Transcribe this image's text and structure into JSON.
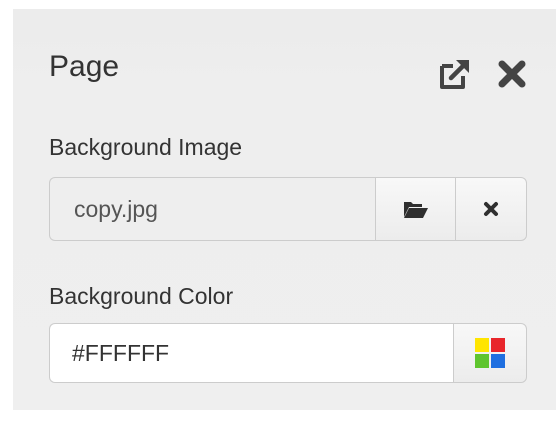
{
  "panel": {
    "title": "Page",
    "popout_icon": "external-link-icon",
    "close_icon": "close-icon"
  },
  "background_image": {
    "label": "Background Image",
    "value": "copy.jpg",
    "browse_icon": "folder-open-icon",
    "clear_icon": "times-icon"
  },
  "background_color": {
    "label": "Background Color",
    "value": "#FFFFFF",
    "picker_icon": "color-palette-icon",
    "swatch_colors": [
      "#FFE500",
      "#E8262B",
      "#5FC52E",
      "#1F6FE0"
    ]
  }
}
